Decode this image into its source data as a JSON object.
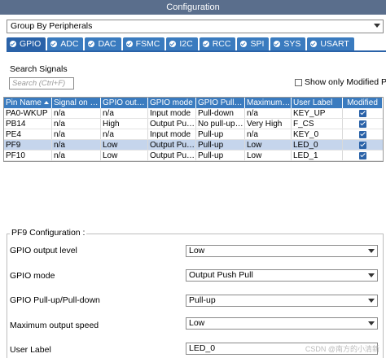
{
  "window": {
    "title": "Configuration"
  },
  "group_by": {
    "value": "Group By Peripherals"
  },
  "tabs": [
    {
      "label": "GPIO",
      "name": "tab-gpio"
    },
    {
      "label": "ADC",
      "name": "tab-adc"
    },
    {
      "label": "DAC",
      "name": "tab-dac"
    },
    {
      "label": "FSMC",
      "name": "tab-fsmc"
    },
    {
      "label": "I2C",
      "name": "tab-i2c"
    },
    {
      "label": "RCC",
      "name": "tab-rcc"
    },
    {
      "label": "SPI",
      "name": "tab-spi"
    },
    {
      "label": "SYS",
      "name": "tab-sys"
    },
    {
      "label": "USART",
      "name": "tab-usart"
    }
  ],
  "active_tab": "GPIO",
  "search": {
    "label": "Search Signals",
    "placeholder": "Search (Ctrl+F)",
    "show_modified_label": "Show only Modified Pins"
  },
  "table": {
    "columns": [
      "Pin Name",
      "Signal on Pin",
      "GPIO output...",
      "GPIO mode",
      "GPIO Pull-up...",
      "Maximum o...",
      "User Label",
      "Modified"
    ],
    "rows": [
      {
        "pin": "PA0-WKUP",
        "signal": "n/a",
        "output": "n/a",
        "mode": "Input mode",
        "pull": "Pull-down",
        "max": "n/a",
        "label": "KEY_UP",
        "modified": true
      },
      {
        "pin": "PB14",
        "signal": "n/a",
        "output": "High",
        "mode": "Output Pus...",
        "pull": "No pull-up a...",
        "max": "Very High",
        "label": "F_CS",
        "modified": true
      },
      {
        "pin": "PE4",
        "signal": "n/a",
        "output": "n/a",
        "mode": "Input mode",
        "pull": "Pull-up",
        "max": "n/a",
        "label": "KEY_0",
        "modified": true
      },
      {
        "pin": "PF9",
        "signal": "n/a",
        "output": "Low",
        "mode": "Output Pus...",
        "pull": "Pull-up",
        "max": "Low",
        "label": "LED_0",
        "modified": true,
        "selected": true
      },
      {
        "pin": "PF10",
        "signal": "n/a",
        "output": "Low",
        "mode": "Output Pus...",
        "pull": "Pull-up",
        "max": "Low",
        "label": "LED_1",
        "modified": true
      }
    ]
  },
  "config": {
    "title": "PF9 Configuration :",
    "fields": [
      {
        "label": "GPIO output level",
        "value": "Low"
      },
      {
        "label": "GPIO mode",
        "value": "Output Push Pull"
      },
      {
        "label": "GPIO Pull-up/Pull-down",
        "value": "Pull-up"
      },
      {
        "label": "Maximum output speed",
        "value": "Low"
      },
      {
        "label": "User Label",
        "value": "LED_0"
      }
    ]
  },
  "watermark": "CSDN @南方的小清新",
  "colors": {
    "titlebar": "#5a6e8c",
    "tab": "#3a7bbf",
    "selected_row": "#c5d5ec"
  }
}
